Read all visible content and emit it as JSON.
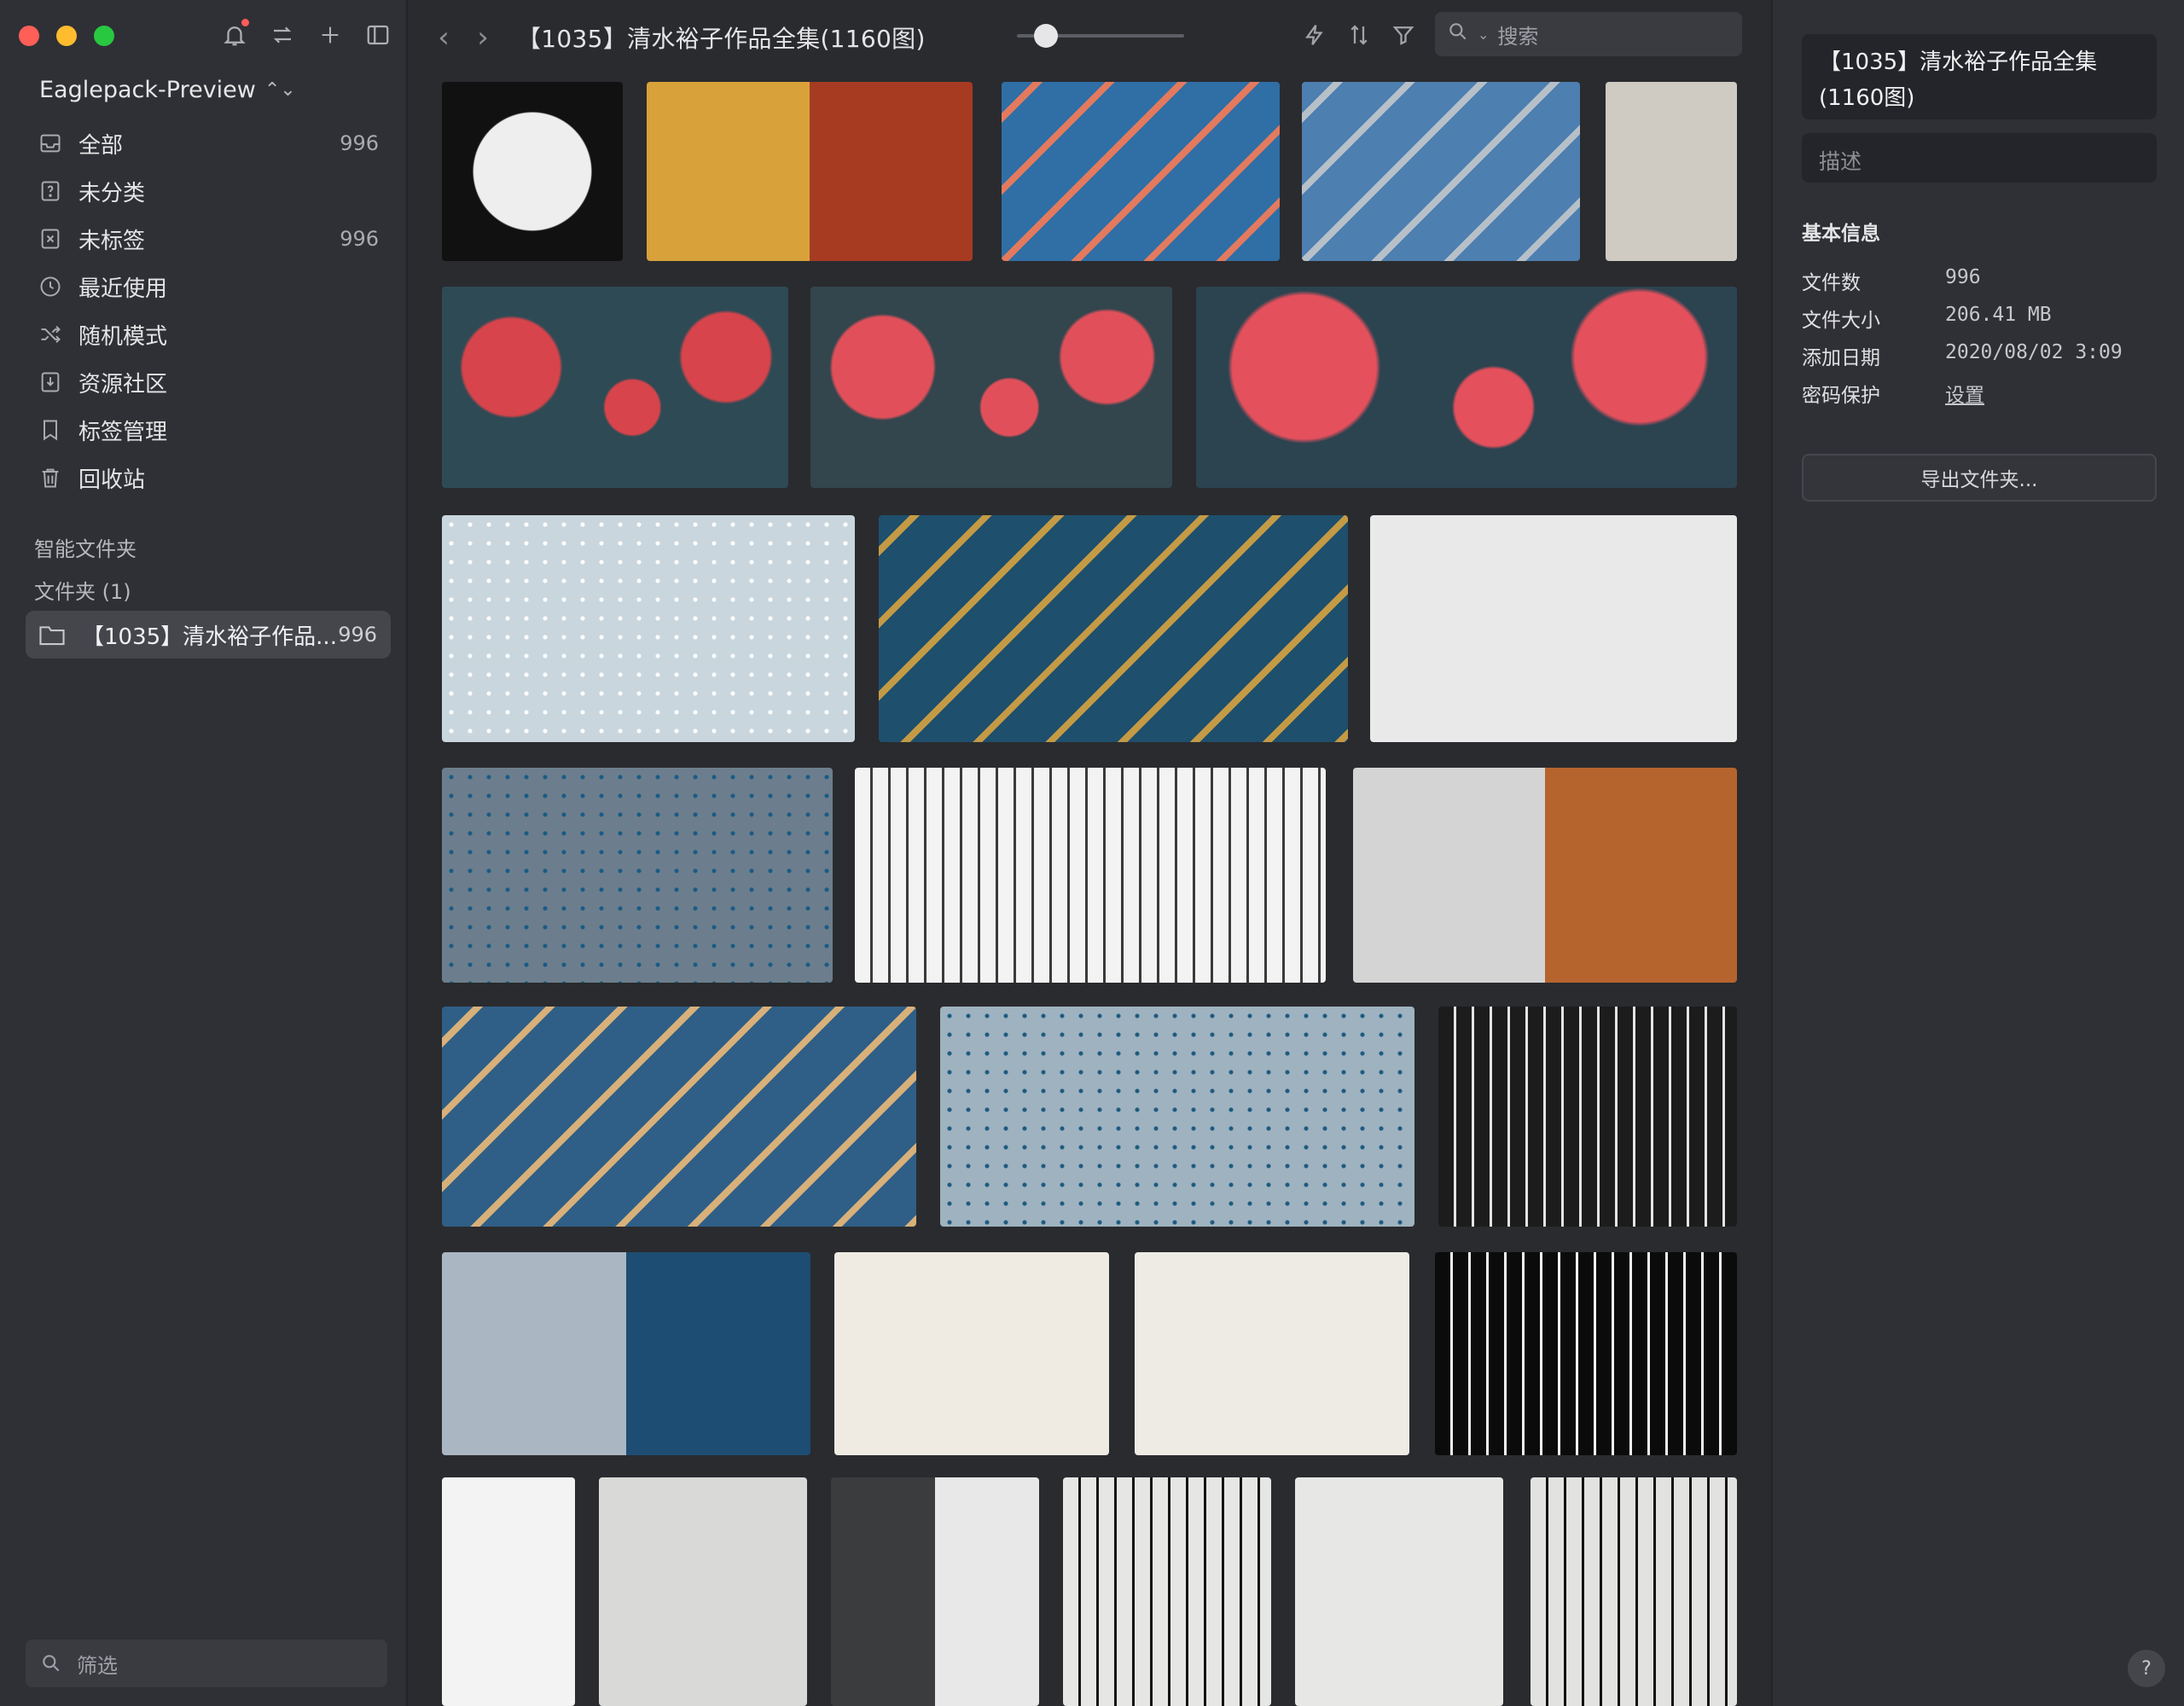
{
  "app": {
    "library": "Eaglepack-Preview"
  },
  "sidebar": {
    "items": [
      {
        "label": "全部",
        "count": "996"
      },
      {
        "label": "未分类",
        "count": ""
      },
      {
        "label": "未标签",
        "count": "996"
      },
      {
        "label": "最近使用",
        "count": ""
      },
      {
        "label": "随机模式",
        "count": ""
      },
      {
        "label": "资源社区",
        "count": ""
      },
      {
        "label": "标签管理",
        "count": ""
      },
      {
        "label": "回收站",
        "count": ""
      }
    ],
    "smart_folders": "智能文件夹",
    "folders_header": "文件夹 (1)",
    "folder": {
      "label": "【1035】清水裕子作品...",
      "count": "996"
    },
    "filter_placeholder": "筛选"
  },
  "toolbar": {
    "title": "【1035】清水裕子作品全集(1160图)",
    "search_placeholder": "搜索"
  },
  "grid": {
    "thumbnails": [
      {
        "name": "thumb-moon-girl",
        "bg": "#111111",
        "fg": "#eeeeee",
        "style": "circle"
      },
      {
        "name": "thumb-comic-spread",
        "bg": "#d9a13a",
        "fg": "#a63b22",
        "style": "split"
      },
      {
        "name": "thumb-wave-mural",
        "bg": "#2f6fa6",
        "fg": "#e37a5e",
        "style": "stripes"
      },
      {
        "name": "thumb-painter-mural",
        "bg": "#4d7fb0",
        "fg": "#b7c0c9",
        "style": "stripes"
      },
      {
        "name": "thumb-lace-sketch",
        "bg": "#cfcac2",
        "fg": "#4b4743",
        "style": "plain"
      },
      {
        "name": "thumb-octopus-waves",
        "bg": "#2e4a55",
        "fg": "#d7444b",
        "style": "blobs"
      },
      {
        "name": "thumb-so-tentacles",
        "bg": "#33454d",
        "fg": "#e1505a",
        "style": "blobs"
      },
      {
        "name": "thumb-yes-tentacles",
        "bg": "#2c4350",
        "fg": "#e4505c",
        "style": "blobs"
      },
      {
        "name": "thumb-snowfield",
        "bg": "#c9d6dd",
        "fg": "#ffffff",
        "style": "snow"
      },
      {
        "name": "thumb-truck-dashboard",
        "bg": "#1e4f6c",
        "fg": "#c49a45",
        "style": "stripes"
      },
      {
        "name": "thumb-moth-book",
        "bg": "#e9e9e9",
        "fg": "#2b2b2b",
        "style": "plain"
      },
      {
        "name": "thumb-truck-door-snow",
        "bg": "#6c7e8d",
        "fg": "#1a5a84",
        "style": "snow"
      },
      {
        "name": "thumb-interior-sketch",
        "bg": "#f3f3f3",
        "fg": "#3a3a3a",
        "style": "lines"
      },
      {
        "name": "thumb-boxes-ps",
        "bg": "#d4d4d4",
        "fg": "#b5642e",
        "style": "split"
      },
      {
        "name": "thumb-supply-truck",
        "bg": "#2f5f86",
        "fg": "#d8b07a",
        "style": "stripes"
      },
      {
        "name": "thumb-jeep-snow",
        "bg": "#9fb2bf",
        "fg": "#1c5a7f",
        "style": "snow"
      },
      {
        "name": "thumb-interior-ink",
        "bg": "#1c1c1c",
        "fg": "#e4e4e4",
        "style": "lines"
      },
      {
        "name": "thumb-truck-ps",
        "bg": "#aab7c2",
        "fg": "#1d4d73",
        "style": "split"
      },
      {
        "name": "thumb-book-page",
        "bg": "#efebe3",
        "fg": "#1e1e1e",
        "style": "plain"
      },
      {
        "name": "thumb-book-window",
        "bg": "#eeebe5",
        "fg": "#2a2a2a",
        "style": "plain"
      },
      {
        "name": "thumb-ink-mountain",
        "bg": "#0b0b0b",
        "fg": "#f2f2f2",
        "style": "lines"
      },
      {
        "name": "thumb-ink-deer",
        "bg": "#f3f3f3",
        "fg": "#1b1b1b",
        "style": "plain"
      },
      {
        "name": "thumb-pencil-flowers",
        "bg": "#d9d9d7",
        "fg": "#666666",
        "style": "plain"
      },
      {
        "name": "thumb-desk-workspace",
        "bg": "#3b3c3e",
        "fg": "#e8e8e8",
        "style": "split"
      },
      {
        "name": "thumb-brush-horse",
        "bg": "#e6e6e4",
        "fg": "#141414",
        "style": "lines"
      },
      {
        "name": "thumb-magnolia",
        "bg": "#e7e7e5",
        "fg": "#3c3c3c",
        "style": "plain"
      },
      {
        "name": "thumb-village-clouds",
        "bg": "#e2e2e0",
        "fg": "#121212",
        "style": "lines"
      }
    ]
  },
  "info": {
    "title": "【1035】清水裕子作品全集(1160图)",
    "desc_placeholder": "描述",
    "section": "基本信息",
    "rows": [
      {
        "k": "文件数",
        "v": "996"
      },
      {
        "k": "文件大小",
        "v": "206.41 MB"
      },
      {
        "k": "添加日期",
        "v": "2020/08/02 3:09"
      },
      {
        "k": "密码保护",
        "v": "设置"
      }
    ],
    "export_label": "导出文件夹...",
    "help": "?"
  }
}
